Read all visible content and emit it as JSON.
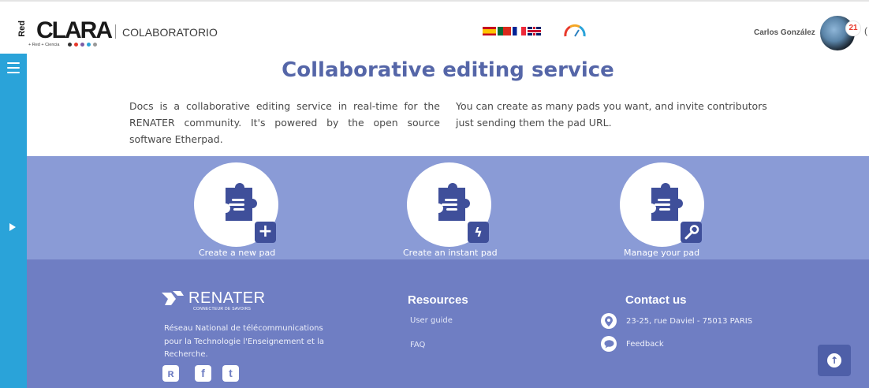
{
  "header": {
    "logo_main": "CLARA",
    "logo_red": "Red",
    "logo_sub": "+ Red  + Ciencia",
    "logo_dot_colors": [
      "#333333",
      "#e8392b",
      "#7b5ba5",
      "#2aa3d9",
      "#999999"
    ],
    "section": "COLABORATORIO",
    "flags": [
      "es",
      "pt",
      "fr",
      "gb"
    ],
    "gauge_icon": "speedometer-icon",
    "username": "Carlos González",
    "notification_count": "21"
  },
  "sidebar": {
    "menu_icon": "hamburger-icon",
    "expand_icon": "play-arrow-icon",
    "color": "#2aa3d9"
  },
  "main": {
    "title": "Collaborative editing service",
    "intro_left": "Docs is a collaborative editing service in real-time for the RENATER community. It's powered by the open source software Etherpad.",
    "intro_right": "You can create as many pads you want, and invite contributors just sending them the pad URL.",
    "actions": [
      {
        "label": "Create a new pad",
        "badge_icon": "plus-icon",
        "badge_glyph": "+"
      },
      {
        "label": "Create an instant pad",
        "badge_icon": "lightning-plus-icon",
        "badge_glyph": "ϟ"
      },
      {
        "label": "Manage your pad",
        "badge_icon": "wrench-icon",
        "badge_glyph": "🔧"
      }
    ]
  },
  "footer": {
    "renater_name": "RENATER",
    "renater_tagline": "CONNECTEUR DE SAVOIRS",
    "renater_desc": "Réseau National de télécommunications pour la Technologie l'Enseignement et la Recherche.",
    "social_icons": [
      "renater-icon",
      "facebook-icon",
      "twitter-icon"
    ],
    "resources_title": "Resources",
    "resources": [
      "User guide",
      "FAQ"
    ],
    "contact_title": "Contact us",
    "address": "23-25, rue Daviel - 75013 PARIS",
    "feedback": "Feedback"
  },
  "colors": {
    "title": "#5566a8",
    "band": "#8a9bd6",
    "footer": "#6f7ec3",
    "badge": "#3f4f9a"
  }
}
